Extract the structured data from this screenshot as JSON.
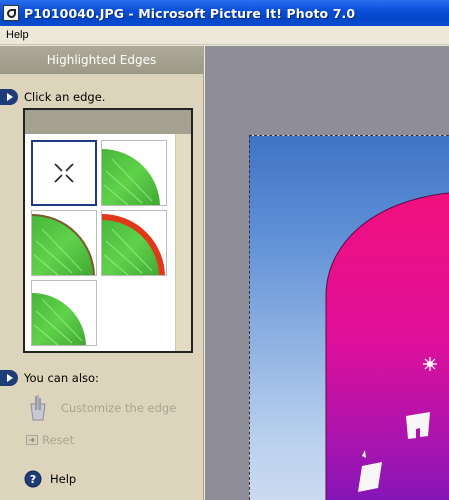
{
  "window": {
    "title": "P1010040.JPG - Microsoft Picture It! Photo 7.0"
  },
  "menubar": {
    "help": "Help"
  },
  "pane": {
    "header": "Highlighted Edges",
    "step1": "Click an edge.",
    "step2": "You can also:",
    "customize": "Customize the edge",
    "reset": "Reset",
    "help": "Help"
  },
  "gallery": {
    "items": [
      {
        "name": "no-edge",
        "selected": true
      },
      {
        "name": "soft-orange-glow",
        "selected": false
      },
      {
        "name": "thin-brown-line",
        "selected": false
      },
      {
        "name": "thick-red-line",
        "selected": false
      },
      {
        "name": "soft-red-fade",
        "selected": false
      }
    ]
  },
  "colors": {
    "title_bar": "#0a50d8",
    "pane_bg": "#ddd5bb",
    "canvas_bg": "#8f8d98",
    "step_arrow": "#1e3c78",
    "magenta": "#e0109a",
    "purple": "#7a16b8"
  },
  "icons": {
    "app": "picture-it-icon",
    "step": "arrow-right-icon",
    "customize": "paintbrush-jar-icon",
    "reset": "reset-arrow-icon",
    "help": "question-circle-icon"
  }
}
